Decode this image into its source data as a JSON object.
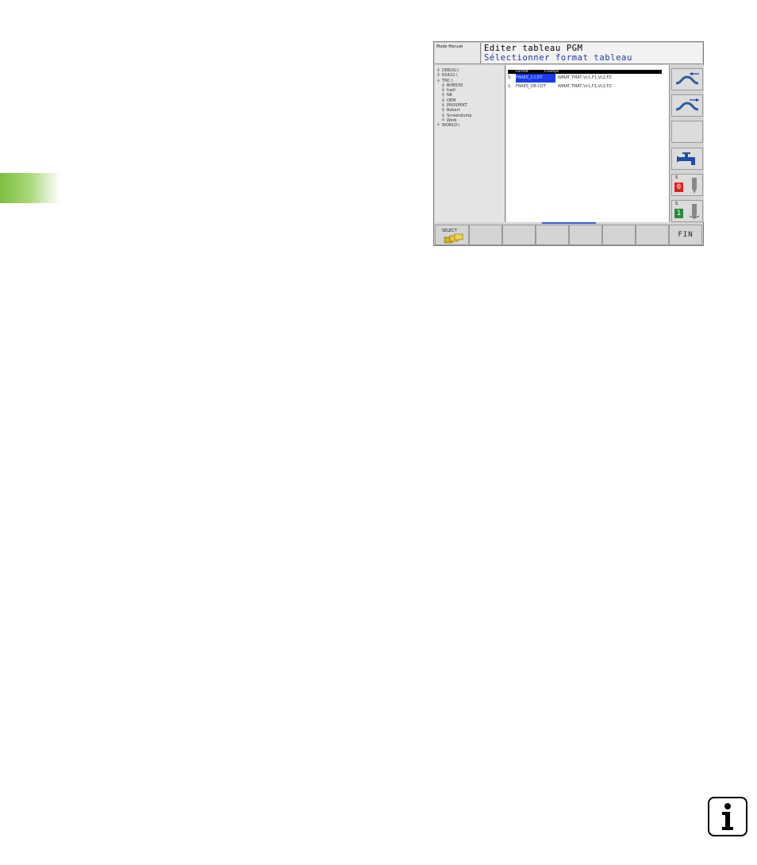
{
  "header": {
    "mode": "Mode Manuel",
    "title": "Editer tableau PGM",
    "subtitle": "Sélectionner format tableau"
  },
  "tree": [
    {
      "label": "DEBUG:\\"
    },
    {
      "label": "RS422:\\"
    },
    {
      "label": "TNC:\\"
    },
    {
      "label": "BHB530"
    },
    {
      "label": "fuell"
    },
    {
      "label": "NK"
    },
    {
      "label": "OEM"
    },
    {
      "label": "PROSPEKT"
    },
    {
      "label": "Robert"
    },
    {
      "label": "Screendump"
    },
    {
      "label": "Work"
    },
    {
      "label": "WORLD:\\"
    }
  ],
  "table": {
    "columns": [
      "Format",
      "Champs"
    ],
    "rows": [
      {
        "index": "0:",
        "format": "FRAES_2.CDT",
        "fields": "WMAT,TMAT,Vc1,F1,Vc2,FZ"
      },
      {
        "index": "1:",
        "format": "FRAES_OB.CDT",
        "fields": "WMAT,TMAT,Vc1,F1,Vc2,FZ"
      }
    ]
  },
  "side_buttons": {
    "s0_label": "S",
    "s0_value": "0",
    "s1_label": "S",
    "s1_value": "1"
  },
  "softkeys": {
    "select_label": "SELECT",
    "fin_label": "FIN"
  },
  "colors": {
    "accent_green": "#7fbf3f",
    "selection_blue": "#1a3af0",
    "subtitle_blue": "#1a3aa8"
  },
  "info_icon": "i"
}
